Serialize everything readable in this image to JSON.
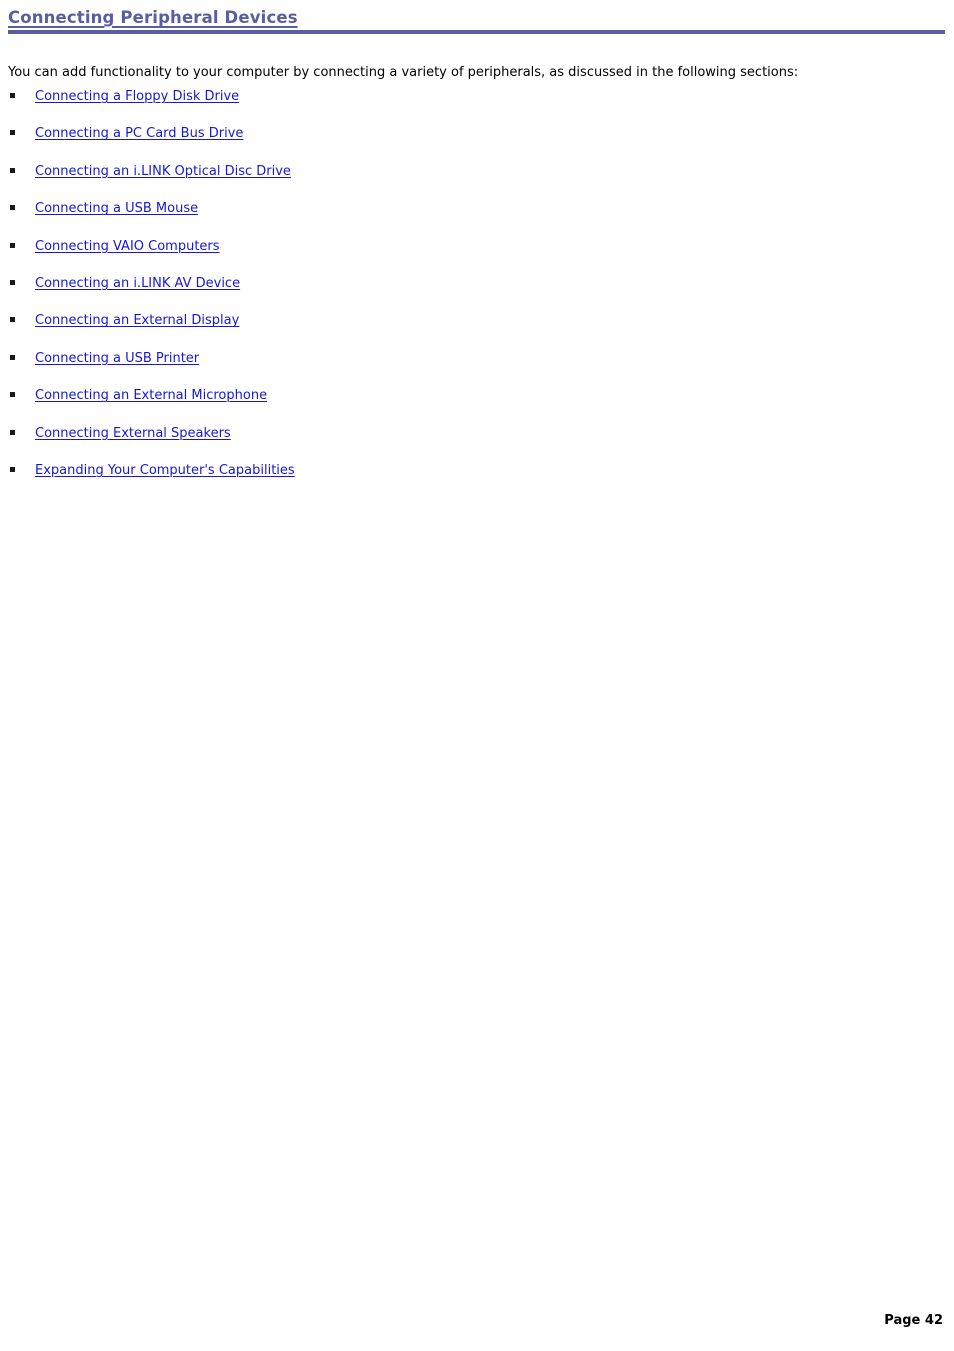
{
  "document": {
    "title": "Connecting Peripheral Devices",
    "intro": "You can add functionality to your computer by connecting a variety of peripherals, as discussed in the following sections:",
    "bullet_icon": "square-bullet-icon",
    "links": [
      {
        "label": "Connecting a Floppy Disk Drive"
      },
      {
        "label": "Connecting a PC Card Bus Drive"
      },
      {
        "label": "Connecting an i.LINK Optical Disc Drive"
      },
      {
        "label": "Connecting a USB Mouse"
      },
      {
        "label": "Connecting VAIO Computers"
      },
      {
        "label": "Connecting an i.LINK AV Device"
      },
      {
        "label": "Connecting an External Display"
      },
      {
        "label": "Connecting a USB Printer"
      },
      {
        "label": "Connecting an External Microphone"
      },
      {
        "label": "Connecting External Speakers"
      },
      {
        "label": "Expanding Your Computer's Capabilities"
      }
    ],
    "footer": {
      "page_label": "Page 42"
    },
    "colors": {
      "heading": "#5b5e9e",
      "rule": "#5b5e9e",
      "link": "#1818cf",
      "text": "#000000",
      "background": "#ffffff"
    }
  }
}
